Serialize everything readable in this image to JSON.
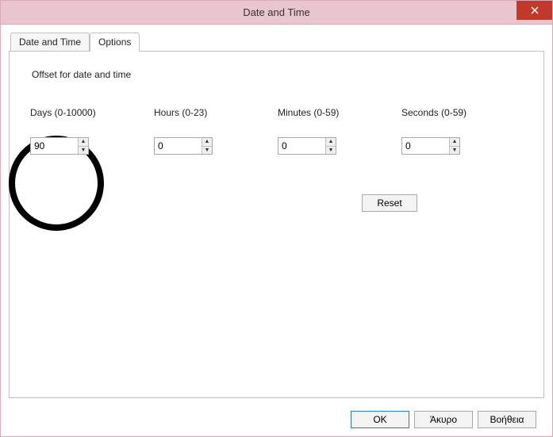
{
  "window": {
    "title": "Date and Time"
  },
  "tabs": {
    "items": [
      {
        "label": "Date and Time"
      },
      {
        "label": "Options"
      }
    ]
  },
  "panel": {
    "section_title": "Offset for date and time",
    "fields": {
      "days": {
        "label": "Days (0-10000)",
        "value": "90"
      },
      "hours": {
        "label": "Hours (0-23)",
        "value": "0"
      },
      "minutes": {
        "label": "Minutes (0-59)",
        "value": "0"
      },
      "seconds": {
        "label": "Seconds (0-59)",
        "value": "0"
      }
    },
    "reset_label": "Reset"
  },
  "footer": {
    "ok": "OK",
    "cancel": "Άκυρο",
    "help": "Βοήθεια"
  }
}
